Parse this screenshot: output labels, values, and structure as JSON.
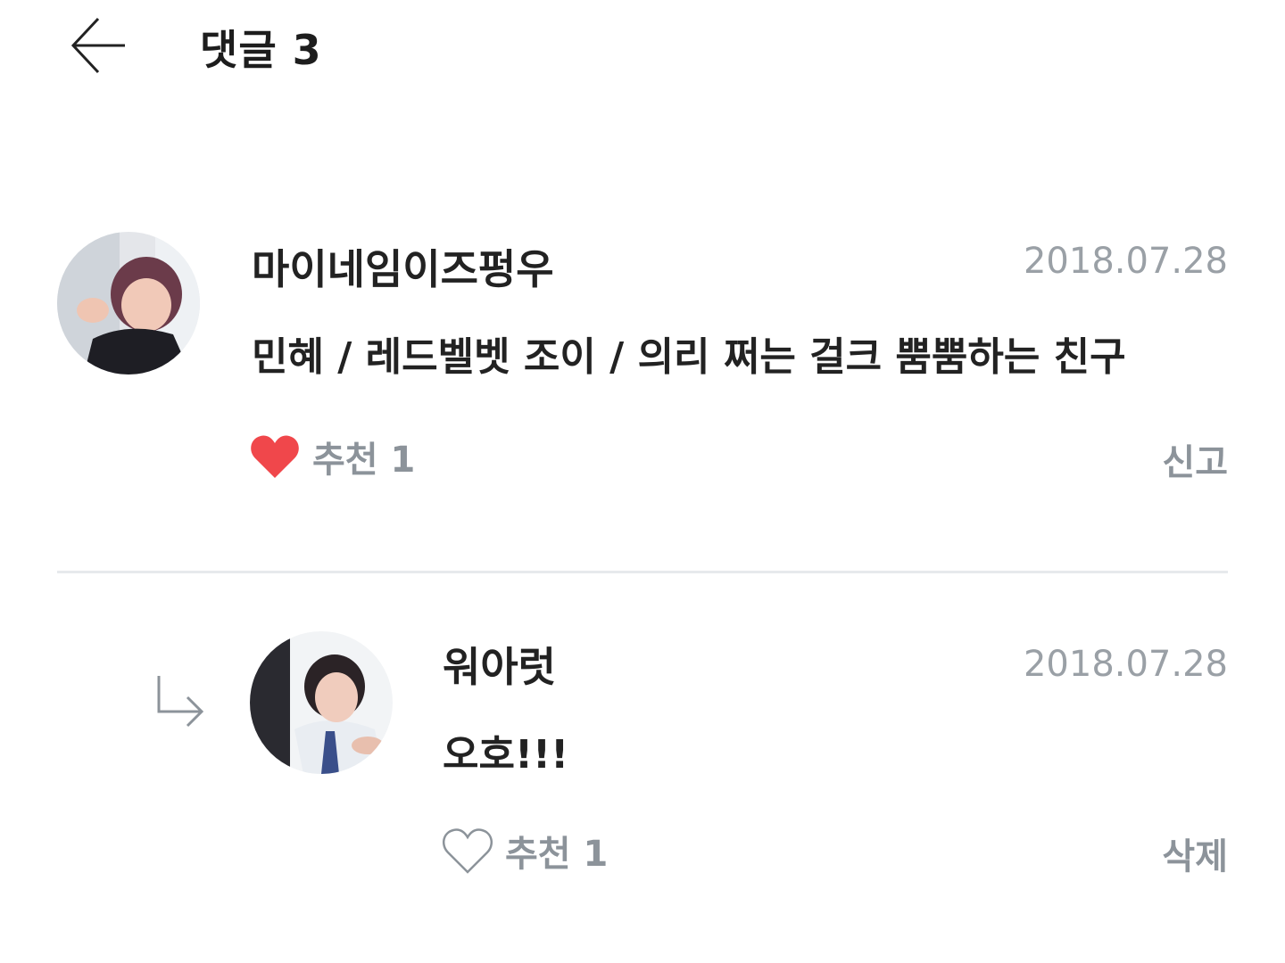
{
  "header": {
    "back_icon": "arrow-left-icon",
    "title": "댓글 3"
  },
  "comments": [
    {
      "author": "마이네임이즈펑우",
      "date": "2018.07.28",
      "text": "민혜 / 레드벨벳 조이 / 의리 쩌는 걸크 뿜뿜하는 친구",
      "like_label": "추천 1",
      "liked": true,
      "action_label": "신고",
      "heart_color": "#f0474b"
    },
    {
      "author": "워아럿",
      "date": "2018.07.28",
      "text": "오호!!!",
      "like_label": "추천 1",
      "liked": false,
      "action_label": "삭제",
      "is_reply": true
    }
  ]
}
